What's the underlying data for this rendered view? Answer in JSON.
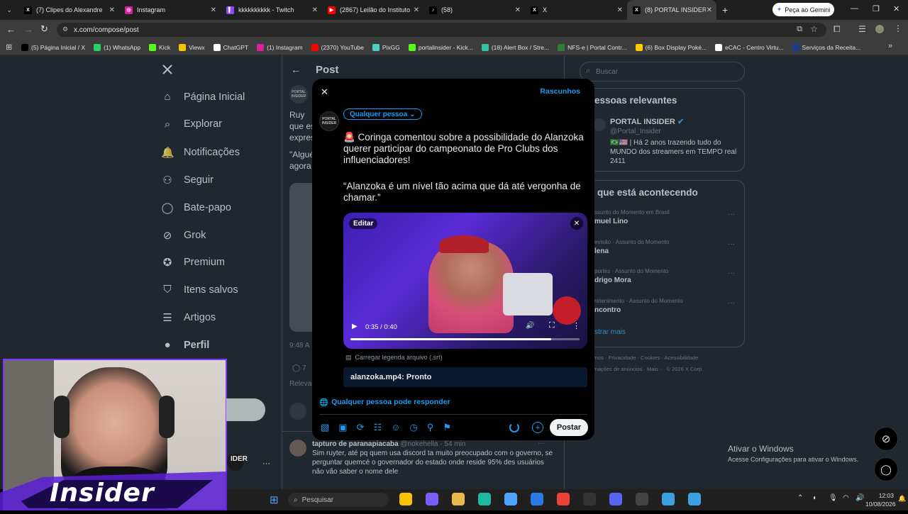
{
  "browser": {
    "tabs": [
      {
        "label": "(7) Clipes do Alexandre",
        "favicon_color": "#000000",
        "favicon_glyph": "X"
      },
      {
        "label": "Instagram",
        "favicon_color": "#d6249f",
        "favicon_glyph": "◎"
      },
      {
        "label": "kkkkkkkkkk - Twitch",
        "favicon_color": "#9146ff",
        "favicon_glyph": "▌"
      },
      {
        "label": "(2867) Leilão do Instituto",
        "favicon_color": "#ff0000",
        "favicon_glyph": "▶"
      },
      {
        "label": "(58)",
        "favicon_color": "#000000",
        "favicon_glyph": "♪"
      },
      {
        "label": "X",
        "favicon_color": "#000000",
        "favicon_glyph": "X"
      },
      {
        "label": "(8) PORTAL INSIDER no X:",
        "favicon_color": "#000000",
        "favicon_glyph": "X"
      }
    ],
    "new_tab": "+",
    "gemini_label": "Peça ao Gemini",
    "url": "x.com/compose/post",
    "bookmarks": [
      {
        "label": "(5) Página Inicial / X",
        "color": "#000000"
      },
      {
        "label": "(1) WhatsApp",
        "color": "#25d366"
      },
      {
        "label": "Kick",
        "color": "#53fc18"
      },
      {
        "label": "Viewx",
        "color": "#f5c400"
      },
      {
        "label": "ChatGPT",
        "color": "#ffffff"
      },
      {
        "label": "(1) Instagram",
        "color": "#d6249f"
      },
      {
        "label": "(2370) YouTube",
        "color": "#ff0000"
      },
      {
        "label": "PixGG",
        "color": "#4ecdc4"
      },
      {
        "label": "portalinsider - Kick...",
        "color": "#53fc18"
      },
      {
        "label": "(18) Alert Box / Stre...",
        "color": "#31c3a2"
      },
      {
        "label": "NFS-e | Portal Contr...",
        "color": "#2e7d32"
      },
      {
        "label": "(6) Box Display Poké...",
        "color": "#ffcc00"
      },
      {
        "label": "eCAC - Centro Virtu...",
        "color": "#ffffff"
      },
      {
        "label": "Serviços da Receita...",
        "color": "#1e3a8a"
      }
    ]
  },
  "sidebar": {
    "items": [
      {
        "label": "Página Inicial",
        "icon": "home-icon"
      },
      {
        "label": "Explorar",
        "icon": "search-icon"
      },
      {
        "label": "Notificações",
        "icon": "bell-icon"
      },
      {
        "label": "Seguir",
        "icon": "add-user-icon"
      },
      {
        "label": "Bate-papo",
        "icon": "chat-icon"
      },
      {
        "label": "Grok",
        "icon": "grok-icon"
      },
      {
        "label": "Premium",
        "icon": "premium-icon"
      },
      {
        "label": "Itens salvos",
        "icon": "bookmark-icon"
      },
      {
        "label": "Artigos",
        "icon": "article-icon"
      },
      {
        "label": "Perfil",
        "icon": "profile-icon"
      }
    ]
  },
  "main": {
    "header": "Post",
    "post_fragments": [
      "Ruy",
      "que es",
      "expres",
      "\"Algué",
      "agora"
    ],
    "time": "9:48 A",
    "reply_count": "7",
    "relevant_label": "Relevan",
    "reply_author": "tapturo de paranapiacaba",
    "reply_handle": "@nokehella · 54 min",
    "reply_text": "Sim ruyter, até pq quem usa discord ta muito preocupado com o governo, se perguntar quemcé o governador do estado onde reside 95% des usuários não vão saber o nome dele"
  },
  "right": {
    "search_placeholder": "Buscar",
    "relevant_title": "essoas relevantes",
    "profile_name": "PORTAL INSIDER",
    "profile_handle": "@Portal_Insider",
    "profile_bio": "🇧🇷🇺🇸 | Há 2 anos trazendo tudo do MUNDO dos streamers em TEMPO real 2411",
    "trending_title": "que está acontecendo",
    "trends": [
      {
        "context": "ssunto do Momento em Brasil",
        "name": "muel Lino"
      },
      {
        "context": "evisão · Assunto do Momento",
        "name": "lena"
      },
      {
        "context": "portes · Assunto do Momento",
        "name": "drigo Mora"
      },
      {
        "context": "retenimento · Assunto do Momento",
        "name": "ncontro"
      }
    ],
    "show_more": "strar mais",
    "footer1": "rmos · Privacidade · Cookies · Acessibilidade",
    "footer2": "rmações de anúncios · Mais ··· © 2026 X Corp."
  },
  "modal": {
    "drafts": "Rascunhos",
    "audience": "Qualquer pessoa",
    "text_p1": "🚨 Coringa comentou sobre a possibilidade do Alanzoka querer participar do campeonato de Pro Clubs dos influenciadores!",
    "text_p2": "“Alanzoka é um nível tão acima que dá até vergonha de chamar.”",
    "edit": "Editar",
    "video_time": "0:35 / 0:40",
    "video_progress": 0.875,
    "caption_upload": "Carregar legenda arquivo (.srt)",
    "file_status": "alanzoka.mp4: Pronto",
    "reply_setting": "Qualquer pessoa pode responder",
    "post_button": "Postar",
    "accent": "#1d9bf0"
  },
  "windows": {
    "activate_title": "Ativar o Windows",
    "activate_sub": "Acesse Configurações para ativar o Windows.",
    "search": "Pesquisar",
    "time": "12:03",
    "date": "10/08/2026"
  },
  "overlay": {
    "logo_text": "Insider"
  }
}
